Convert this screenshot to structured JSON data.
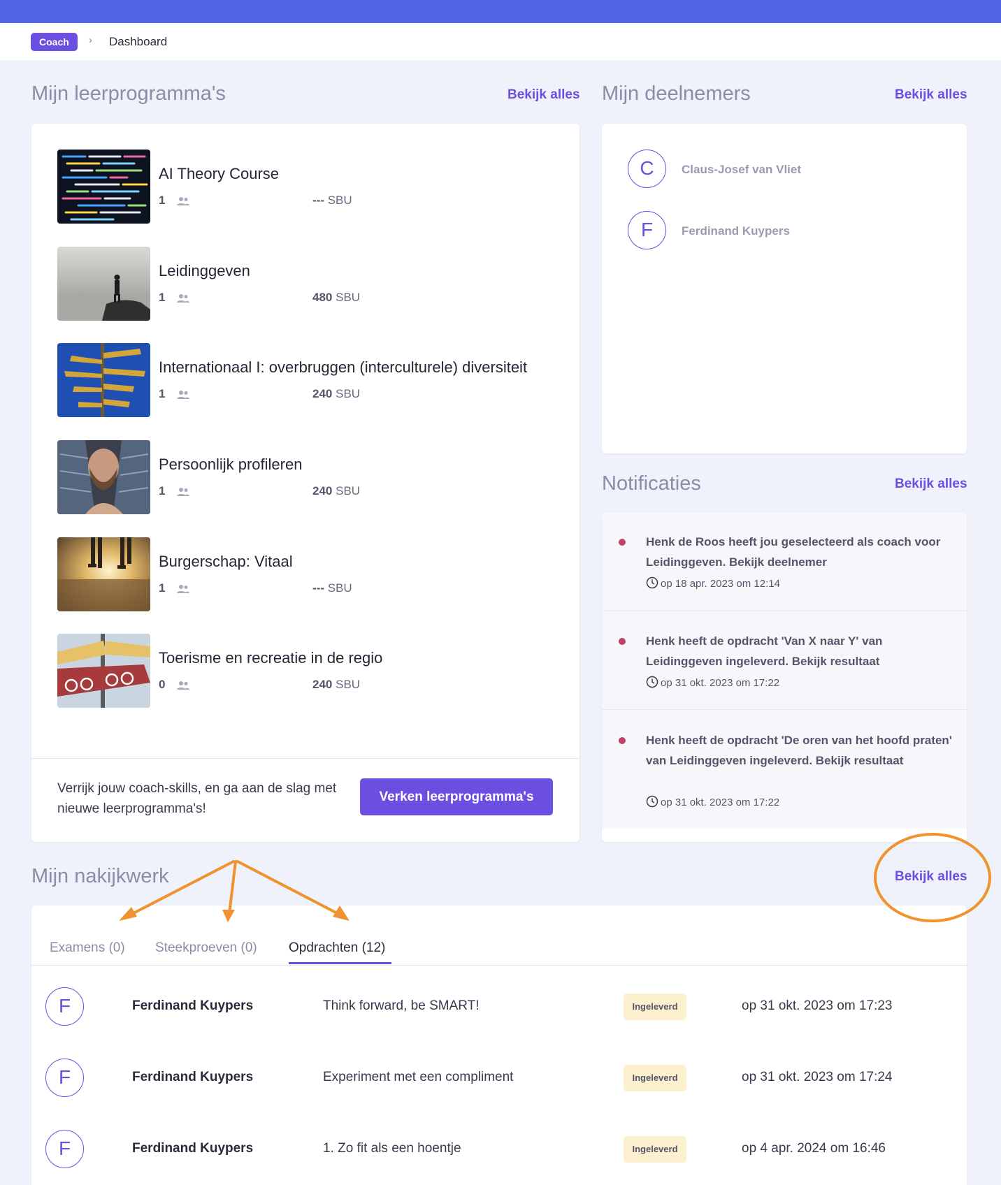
{
  "breadcrumb": {
    "role": "Coach",
    "current": "Dashboard"
  },
  "programs_section": {
    "title": "Mijn leerprogramma's",
    "view_all": "Bekijk alles",
    "items": [
      {
        "title": "AI Theory Course",
        "count": "1",
        "sbu_value": "---",
        "sbu_unit": "SBU"
      },
      {
        "title": "Leidinggeven",
        "count": "1",
        "sbu_value": "480",
        "sbu_unit": "SBU"
      },
      {
        "title": "Internationaal I: overbruggen (interculturele) diversiteit",
        "count": "1",
        "sbu_value": "240",
        "sbu_unit": "SBU"
      },
      {
        "title": "Persoonlijk profileren",
        "count": "1",
        "sbu_value": "240",
        "sbu_unit": "SBU"
      },
      {
        "title": "Burgerschap: Vitaal",
        "count": "1",
        "sbu_value": "---",
        "sbu_unit": "SBU"
      },
      {
        "title": "Toerisme en recreatie in de regio",
        "count": "0",
        "sbu_value": "240",
        "sbu_unit": "SBU"
      }
    ],
    "cta_text": "Verrijk jouw coach-skills, en ga aan de slag met nieuwe leerprogramma's!",
    "cta_button": "Verken leerprogramma's"
  },
  "participants_section": {
    "title": "Mijn deelnemers",
    "view_all": "Bekijk alles",
    "items": [
      {
        "initial": "C",
        "name": "Claus-Josef van Vliet"
      },
      {
        "initial": "F",
        "name": "Ferdinand Kuypers"
      }
    ]
  },
  "notifications_section": {
    "title": "Notificaties",
    "view_all": "Bekijk alles",
    "items": [
      {
        "text": "Henk de Roos heeft jou geselecteerd als coach voor Leidinggeven. Bekijk deelnemer",
        "time": "op 18 apr. 2023 om 12:14"
      },
      {
        "text": "Henk heeft de opdracht 'Van X naar Y' van Leidinggeven ingeleverd. Bekijk resultaat",
        "time": "op 31 okt. 2023 om 17:22"
      },
      {
        "text": "Henk heeft de opdracht 'De oren van het hoofd praten' van Leidinggeven ingeleverd. Bekijk resultaat",
        "time": "op 31 okt. 2023 om 17:22"
      }
    ]
  },
  "review_section": {
    "title": "Mijn nakijkwerk",
    "view_all": "Bekijk alles",
    "tabs": [
      {
        "label": "Examens (0)"
      },
      {
        "label": "Steekproeven (0)"
      },
      {
        "label": "Opdrachten (12)"
      }
    ],
    "rows": [
      {
        "initial": "F",
        "name": "Ferdinand Kuypers",
        "task": "Think forward, be SMART!",
        "status": "Ingeleverd",
        "date": "op 31 okt. 2023 om 17:23"
      },
      {
        "initial": "F",
        "name": "Ferdinand Kuypers",
        "task": "Experiment met een compliment",
        "status": "Ingeleverd",
        "date": "op 31 okt. 2023 om 17:24"
      },
      {
        "initial": "F",
        "name": "Ferdinand Kuypers",
        "task": "1. Zo fit als een hoentje",
        "status": "Ingeleverd",
        "date": "op 4 apr. 2024 om 16:46"
      }
    ]
  },
  "colors": {
    "accent": "#6a4fe0",
    "topbar": "#5065e6",
    "annotation": "#f0922e",
    "notification_dot": "#c2406a",
    "status_bg": "#fdf0cf"
  }
}
